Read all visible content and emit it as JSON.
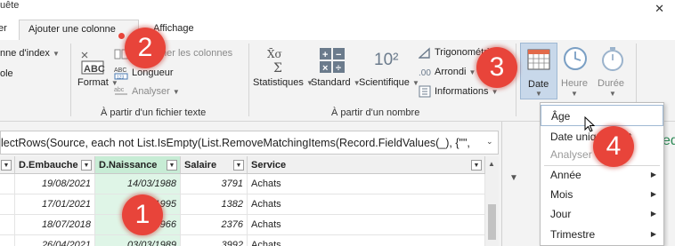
{
  "window": {
    "title_fragment": "uête",
    "close_glyph": "✕"
  },
  "tabs": [
    {
      "label": "er"
    },
    {
      "label": "Ajouter une colonne"
    },
    {
      "label": "Affichage"
    }
  ],
  "ribbon": {
    "index_column": "nne d'index",
    "left_fragment": "ole",
    "format_label": "Format",
    "merge_columns": "Fusionner les colonnes",
    "length_label": "Longueur",
    "parse_label": "Analyser",
    "group_text": "À partir d'un fichier texte",
    "statistics": "Statistiques",
    "standard": "Standard",
    "scientific": "Scientifique",
    "trigonometry": "Trigonométrie",
    "rounding": "Arrondi",
    "information": "Informations",
    "group_number": "À partir d'un nombre",
    "date": "Date",
    "time": "Heure",
    "duration": "Durée",
    "icon_exp": "10²",
    "icon_sigma": "Σ"
  },
  "formula": {
    "text": "lectRows(Source, each not List.IsEmpty(List.RemoveMatchingItems(Record.FieldValues(_), {\"\","
  },
  "table": {
    "headers": [
      "D.Embauche",
      "D.Naissance",
      "Salaire",
      "Service"
    ],
    "rows": [
      [
        "19/08/2021",
        "14/03/1988",
        "3791",
        "Achats"
      ],
      [
        "17/01/2021",
        "01/05/1995",
        "1382",
        "Achats"
      ],
      [
        "18/07/2018",
        "04/05/1966",
        "2376",
        "Achats"
      ],
      [
        "26/04/2021",
        "03/03/1989",
        "3992",
        "Achats"
      ]
    ]
  },
  "date_menu": {
    "items": [
      {
        "label": "Âge"
      },
      {
        "label": "Date uniquement"
      },
      {
        "label": "Analyser"
      },
      {
        "label": "Année"
      },
      {
        "label": "Mois"
      },
      {
        "label": "Jour"
      },
      {
        "label": "Trimestre"
      }
    ]
  },
  "right_fragment": "eq",
  "badges": [
    "2",
    "3",
    "4",
    "1"
  ],
  "colors": {
    "badge": "#e8443a",
    "selected_column": "#c7ecd5",
    "date_button": "#c8d8ea"
  }
}
